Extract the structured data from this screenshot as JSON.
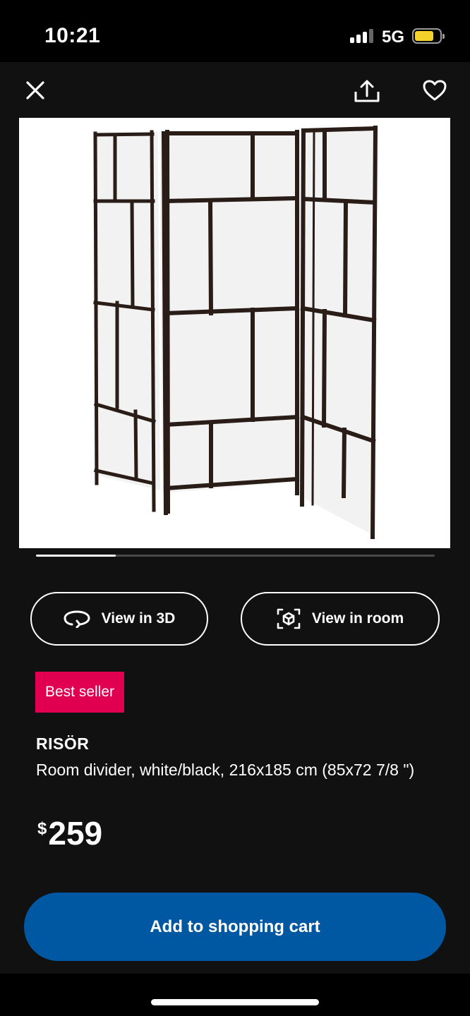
{
  "status_bar": {
    "time": "10:21",
    "network": "5G",
    "battery_color": "#f2d22b"
  },
  "top_bar": {
    "close_icon": "close-icon",
    "share_icon": "share-icon",
    "favorite_icon": "heart-icon"
  },
  "gallery": {
    "image_alt": "RISÖR room divider",
    "slide_progress": 0.2
  },
  "actions": {
    "view_3d_label": "View in 3D",
    "view_room_label": "View in room"
  },
  "product": {
    "badge": "Best seller",
    "badge_color": "#e0004f",
    "name": "RISÖR",
    "description": "Room divider, white/black, 216x185 cm (85x72 7/8 \")",
    "price_currency": "$",
    "price_amount": "259"
  },
  "cart": {
    "button_label": "Add to shopping cart",
    "button_color": "#0058a3"
  }
}
